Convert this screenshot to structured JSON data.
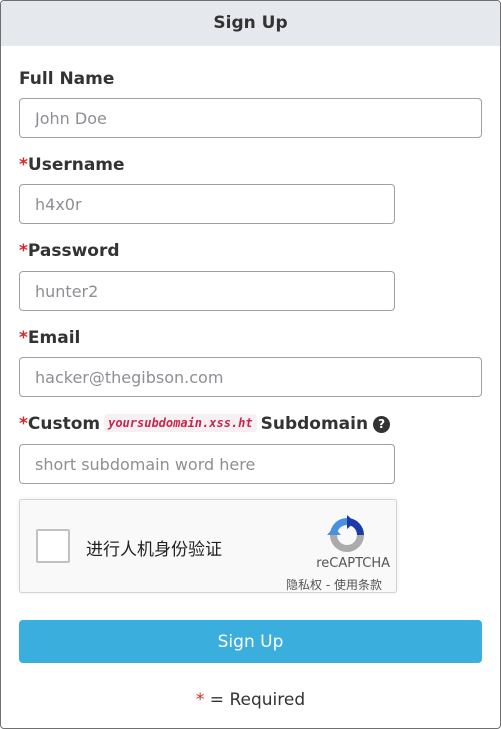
{
  "header": {
    "title": "Sign Up"
  },
  "form": {
    "required_marker": "*",
    "full_name": {
      "label": "Full Name",
      "placeholder": "John Doe",
      "value": ""
    },
    "username": {
      "label": "Username",
      "placeholder": "h4x0r",
      "value": ""
    },
    "password": {
      "label": "Password",
      "placeholder": "hunter2",
      "value": ""
    },
    "email": {
      "label": "Email",
      "placeholder": "hacker@thegibson.com",
      "value": ""
    },
    "subdomain": {
      "label_prefix": "Custom",
      "code": "yoursubdomain.xss.ht",
      "label_suffix": "Subdomain",
      "help_icon": "question-circle-icon",
      "help_glyph": "?",
      "placeholder": "short subdomain word here",
      "value": ""
    },
    "captcha": {
      "label": "进行人机身份验证",
      "brand": "reCAPTCHA",
      "links": "隐私权 - 使用条款"
    },
    "submit_label": "Sign Up",
    "required_note": "= Required"
  },
  "colors": {
    "header_bg": "#e5e8ec",
    "required": "#d9252b",
    "button": "#3aaedc",
    "code_text": "#c7254e"
  }
}
